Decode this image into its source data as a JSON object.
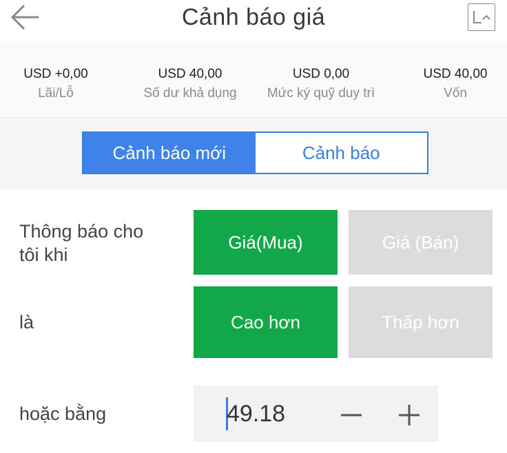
{
  "header": {
    "title": "Cảnh báo giá",
    "back_icon": "arrow-left-icon",
    "chart_icon": "line-chart-icon"
  },
  "summary": [
    {
      "value": "USD +0,00",
      "label": "Lãi/Lỗ"
    },
    {
      "value": "USD 40,00",
      "label": "Số dư khả dụng"
    },
    {
      "value": "USD 0,00",
      "label": "Mức ký quỹ duy trì"
    },
    {
      "value": "USD 40,00",
      "label": "Vốn"
    }
  ],
  "tabs": [
    {
      "label": "Cảnh báo mới",
      "active": true
    },
    {
      "label": "Cảnh báo",
      "active": false
    }
  ],
  "form": {
    "notify_label": "Thông báo cho\ntôi khi",
    "price_options": [
      {
        "label": "Giá(Mua)",
        "selected": true
      },
      {
        "label": "Giá (Bán)",
        "selected": false
      }
    ],
    "condition_label": "là",
    "condition_options": [
      {
        "label": "Cao hơn",
        "selected": true
      },
      {
        "label": "Thấp hơn",
        "selected": false
      }
    ],
    "or_equal_label": "hoặc bằng",
    "price_value": "49.18"
  },
  "colors": {
    "accent_blue": "#3f82ea",
    "selected_green": "#12a84a",
    "unselected_gray": "#dcdcdc"
  }
}
